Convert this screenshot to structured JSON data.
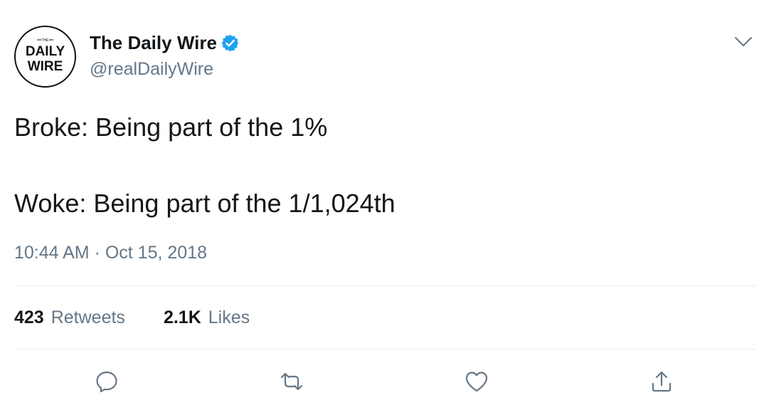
{
  "tweet": {
    "author": {
      "display_name": "The Daily Wire",
      "handle": "@realDailyWire",
      "verified": true,
      "avatar_logo": {
        "small_text": "THE",
        "line1": "DAILY",
        "line2": "WIRE"
      }
    },
    "menu_icon": "chevron-down-icon",
    "text_lines": [
      "Broke: Being part of the 1%",
      "Woke: Being part of the 1/1,024th"
    ],
    "timestamp": "10:44 AM · Oct 15, 2018",
    "stats": {
      "retweets_count": "423",
      "retweets_label": "Retweets",
      "likes_count": "2.1K",
      "likes_label": "Likes"
    },
    "actions": [
      "reply-icon",
      "retweet-icon",
      "like-icon",
      "share-icon"
    ]
  },
  "colors": {
    "primary_text": "#14171a",
    "secondary_text": "#657786",
    "divider": "#e6ecf0",
    "verified_badge": "#1da1f2",
    "action_icon": "#657786"
  }
}
